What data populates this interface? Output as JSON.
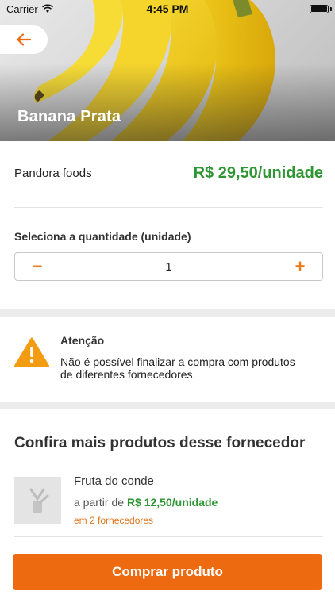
{
  "status_bar": {
    "carrier": "Carrier",
    "time": "4:45 PM"
  },
  "product": {
    "title": "Banana Prata",
    "supplier": "Pandora foods",
    "price": "R$ 29,50/unidade"
  },
  "quantity": {
    "label": "Seleciona a quantidade (unidade)",
    "minus": "−",
    "value": "1",
    "plus": "+"
  },
  "warning": {
    "title": "Atenção",
    "text": "Não é possível finalizar a compra com produtos de diferentes fornecedores."
  },
  "more_products": {
    "title": "Confira mais produtos desse fornecedor",
    "items": [
      {
        "name": "Fruta do conde",
        "price_prefix": "a partir de",
        "price": "R$ 12,50/unidade",
        "suppliers": "em 2 fornecedores"
      }
    ]
  },
  "actions": {
    "buy": "Comprar produto"
  },
  "colors": {
    "accent": "#ee6a10",
    "price": "#2e9632",
    "warning": "#f39c12"
  },
  "icons": {
    "back": "arrow-left-icon",
    "warning": "warning-triangle-icon",
    "placeholder": "image-placeholder-icon"
  }
}
